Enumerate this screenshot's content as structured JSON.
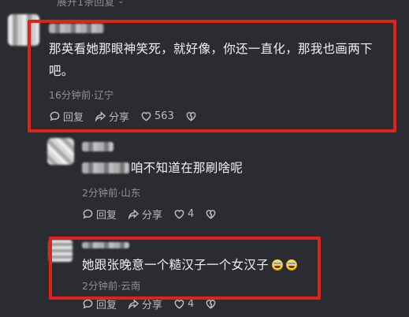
{
  "collapse": {
    "label": "展开1条回复",
    "chevron": "chevron-down-icon"
  },
  "comments": [
    {
      "text": "那英看她那眼神笑死，就好像，你还一直化，那我也画两下吧。",
      "meta": "16分钟前·辽宁",
      "reply_label": "回复",
      "share_label": "分享",
      "like_count": "563"
    },
    {
      "text": "咱不知道在那刷啥呢",
      "meta": "2分钟前·山东",
      "reply_label": "回复",
      "share_label": "分享",
      "like_count": "4"
    },
    {
      "text": "她跟张晚意一个糙汉子一个女汉子",
      "meta": "2分钟前·云南",
      "reply_label": "回复",
      "share_label": "分享",
      "like_count": "4"
    }
  ],
  "colors": {
    "background": "#2a2c32",
    "highlight": "#e0221c",
    "text": "#f1f1f3",
    "muted": "#8d9097"
  }
}
